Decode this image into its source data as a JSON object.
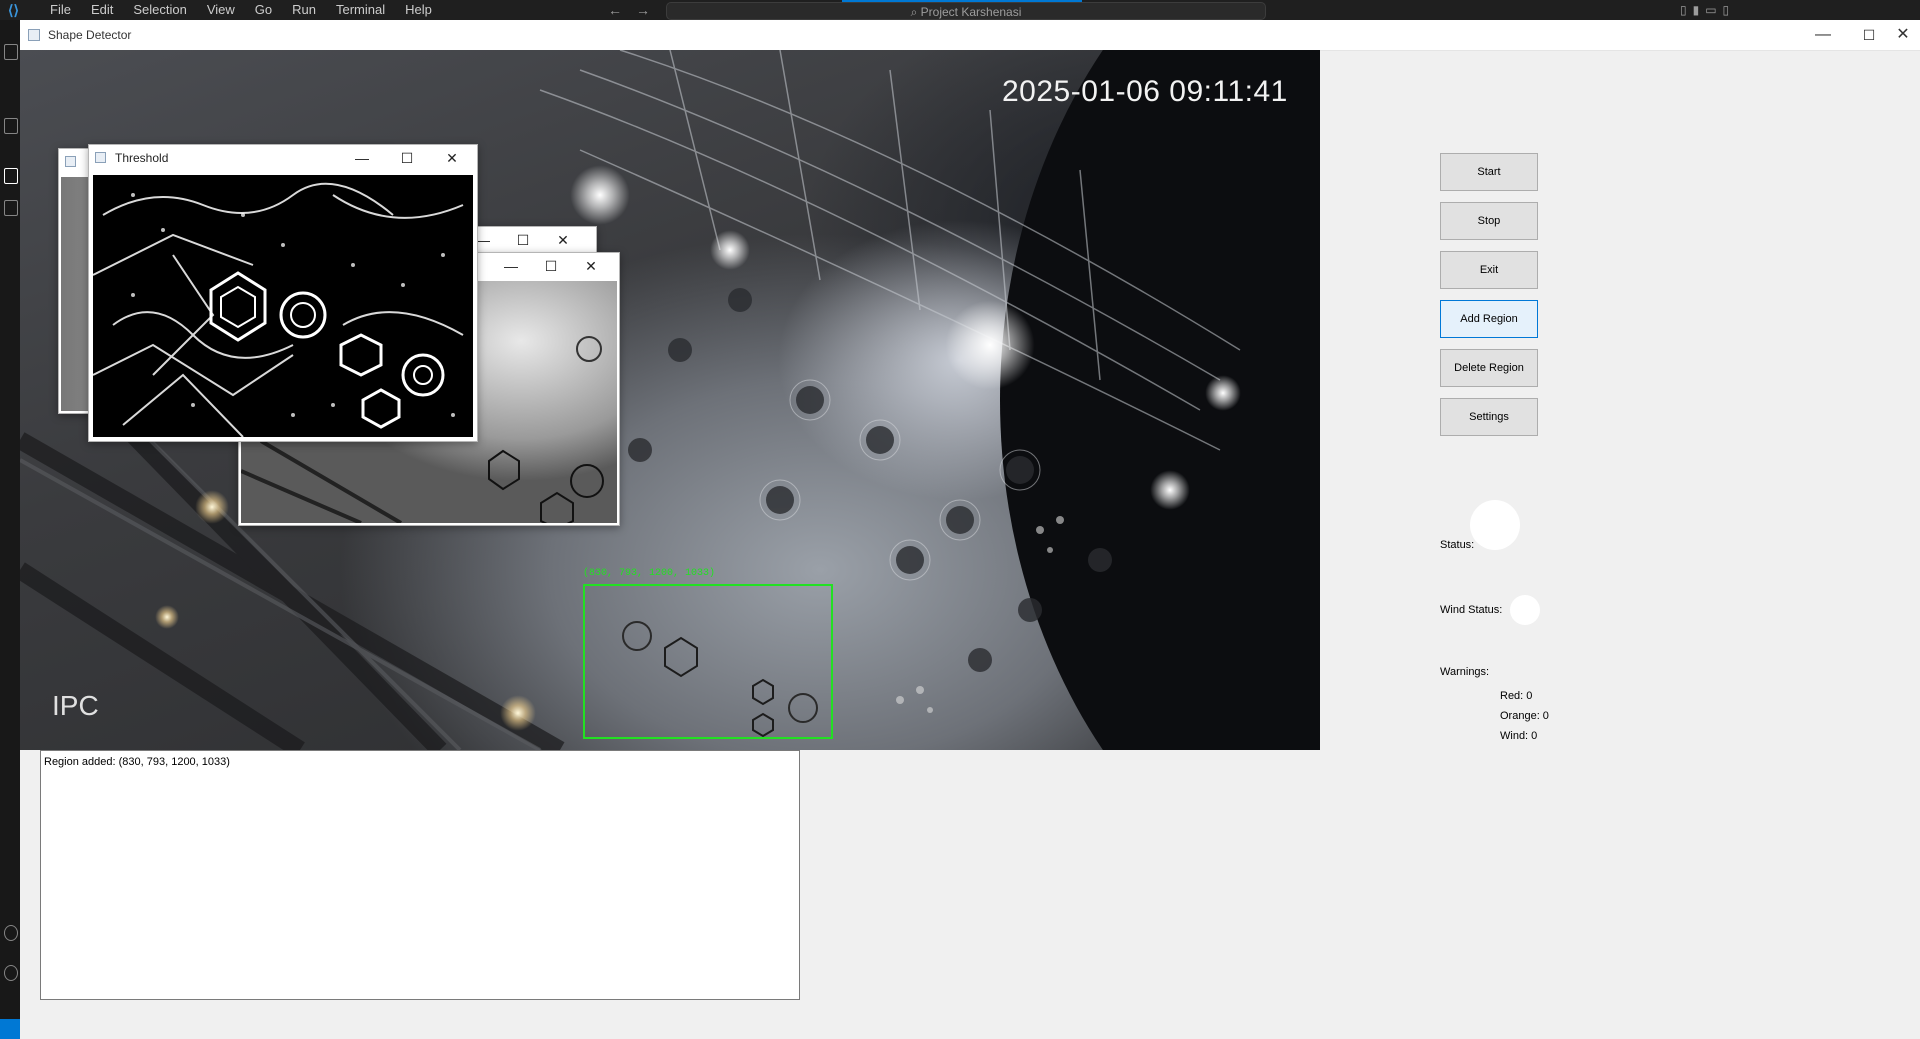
{
  "vscode": {
    "menu": [
      "File",
      "Edit",
      "Selection",
      "View",
      "Go",
      "Run",
      "Terminal",
      "Help"
    ],
    "search_text": "Project Karshenasi"
  },
  "window": {
    "title": "Shape Detector",
    "minimize": "—",
    "maximize": "☐",
    "close": "✕"
  },
  "video": {
    "timestamp": "2025-01-06 09:11:41",
    "overlay_logo": "IPC",
    "region_label": "(830, 793, 1200, 1033)"
  },
  "cv_windows": {
    "threshold_title": "Threshold",
    "min": "—",
    "max": "☐",
    "close": "✕"
  },
  "controls": {
    "start": "Start",
    "stop": "Stop",
    "exit": "Exit",
    "add_region": "Add Region",
    "delete_region": "Delete Region",
    "settings": "Settings"
  },
  "status": {
    "status_label": "Status:",
    "wind_status_label": "Wind Status:",
    "status_color": "#ffffff",
    "wind_color": "#ffffff"
  },
  "warnings": {
    "heading": "Warnings:",
    "red": "Red: 0",
    "orange": "Orange: 0",
    "wind": "Wind: 0"
  },
  "log": {
    "lines": [
      "Region added: (830, 793, 1200, 1033)"
    ]
  },
  "colors": {
    "region_box": "#22e122",
    "focus_border": "#0078d7"
  }
}
